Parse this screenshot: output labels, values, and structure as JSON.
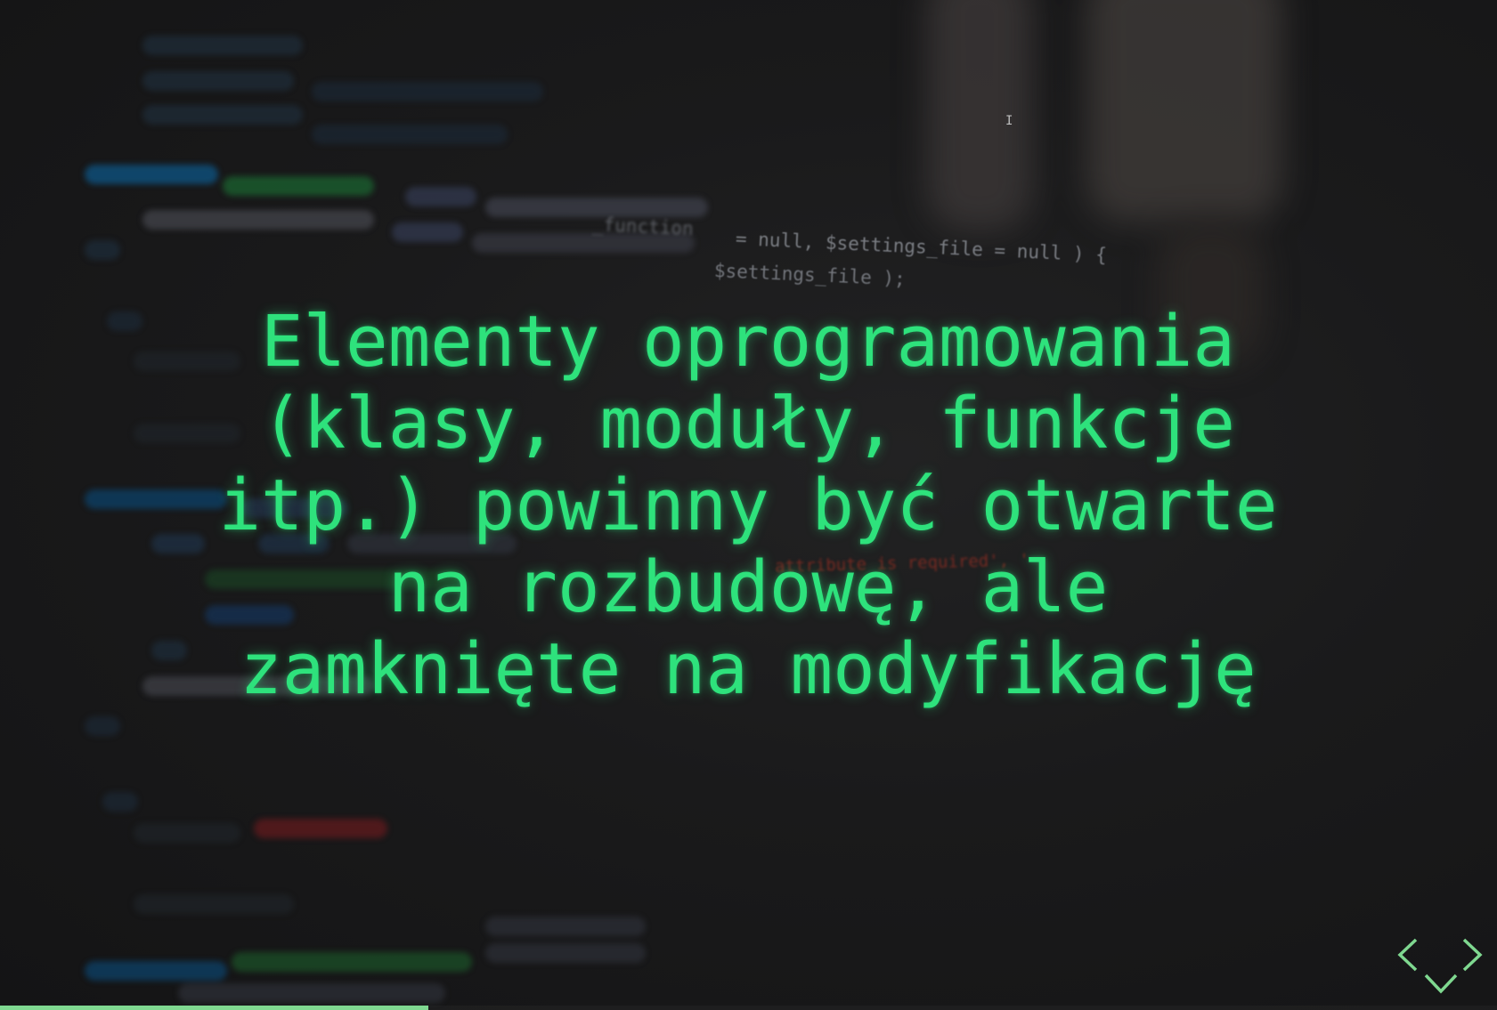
{
  "slide": {
    "title": "Elementy oprogramowania\n(klasy, moduły, funkcje\nitp.) powinny być otwarte\nna rozbudowę, ale\nzamknięte na modyfikację"
  },
  "background": {
    "code_line_1": "= null, $settings_file = null ) {",
    "code_line_2": "$settings_file );",
    "code_line_3": "attribute is required', '",
    "code_line_4": "_function"
  },
  "navigation": {
    "prev_icon": "chevron-left-icon",
    "next_icon": "chevron-right-icon",
    "down_icon": "chevron-down-icon"
  },
  "progress": {
    "fraction": 0.286
  },
  "colors": {
    "accent": "#2ee27c",
    "controls": "#7fd890",
    "background": "#161617"
  }
}
